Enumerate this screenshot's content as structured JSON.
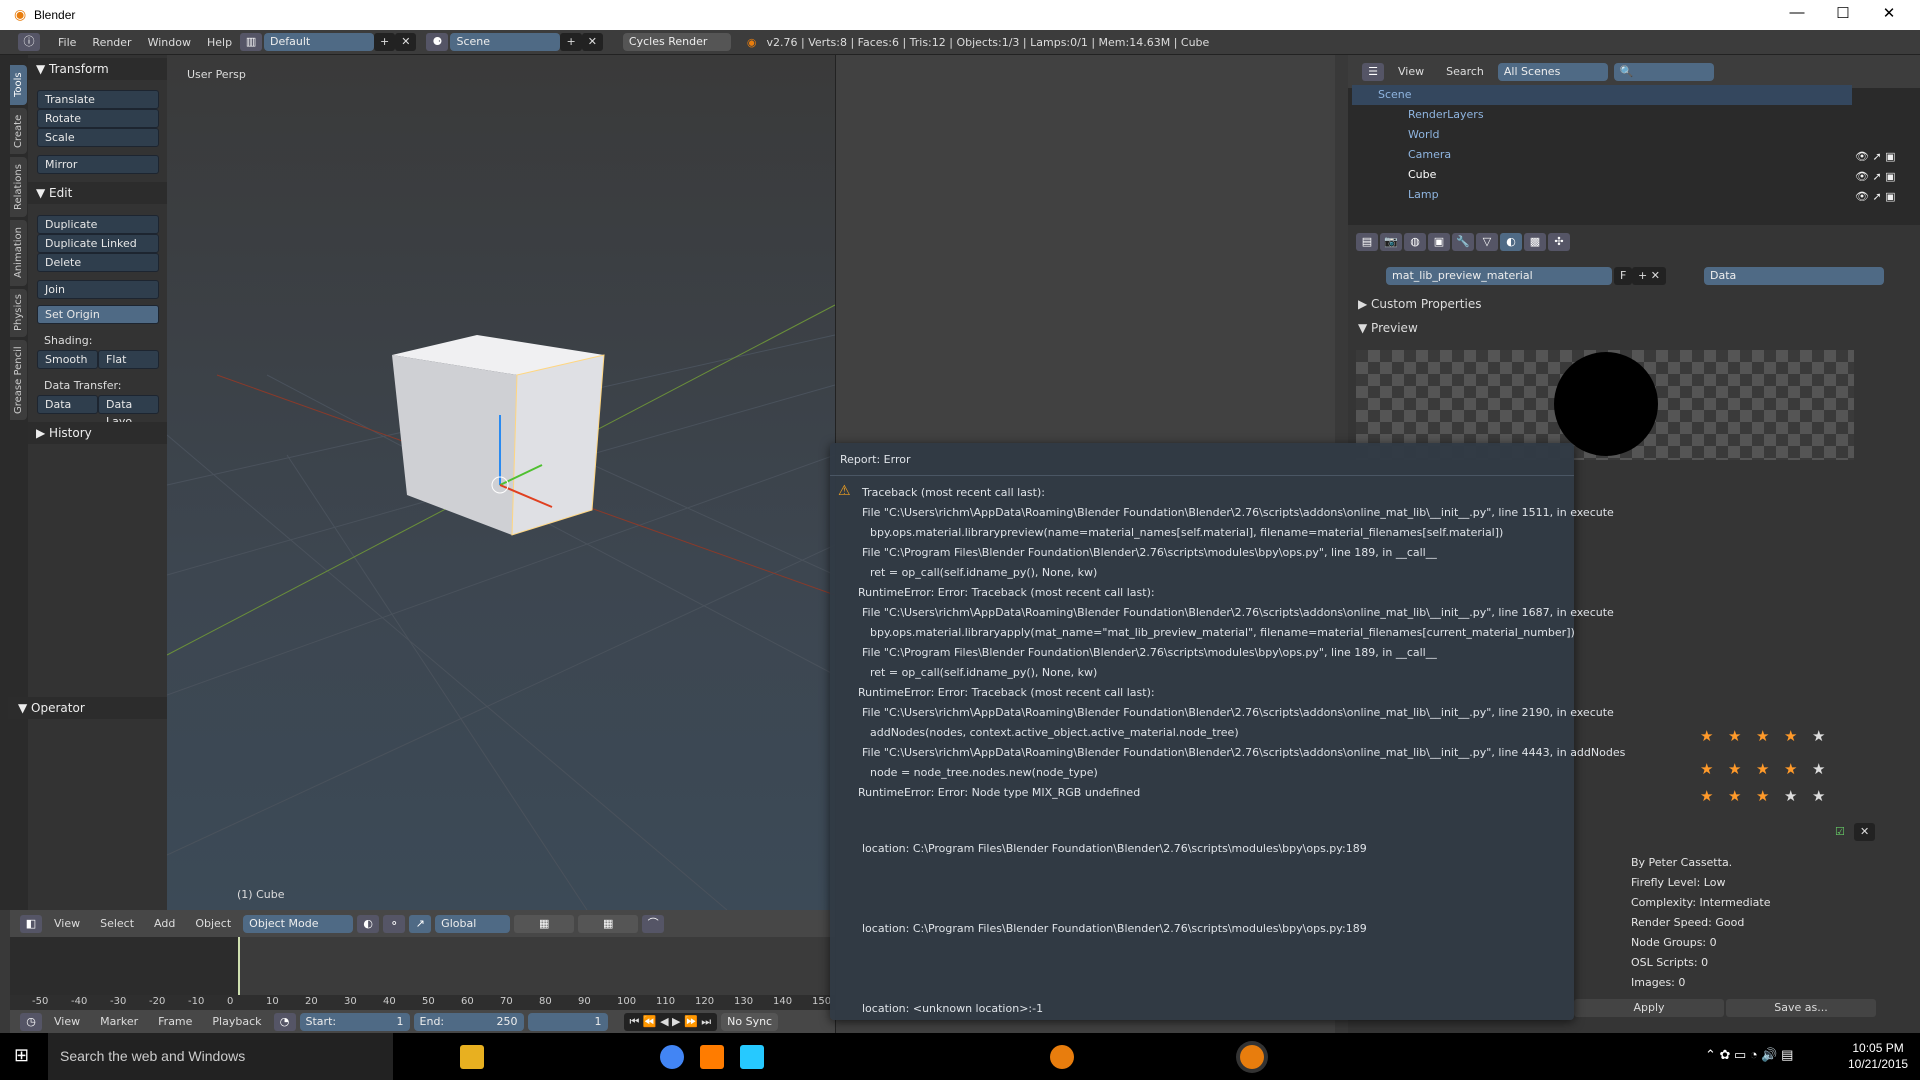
{
  "window": {
    "title": "Blender",
    "min": "—",
    "max": "☐",
    "close": "✕"
  },
  "topbar": {
    "menus": [
      "File",
      "Render",
      "Window",
      "Help"
    ],
    "layout": "Default",
    "scene": "Scene",
    "engine": "Cycles Render",
    "stats": "v2.76 | Verts:8 | Faces:6 | Tris:12 | Objects:1/3 | Lamps:0/1 | Mem:14.63M | Cube"
  },
  "toolshelf": {
    "tabs": [
      "Tools",
      "Create",
      "Relations",
      "Animation",
      "Physics",
      "Grease Pencil"
    ],
    "transform": "Transform",
    "translate": "Translate",
    "rotate": "Rotate",
    "scale": "Scale",
    "mirror": "Mirror",
    "edit": "Edit",
    "duplicate": "Duplicate",
    "duplicate_linked": "Duplicate Linked",
    "delete": "Delete",
    "join": "Join",
    "set_origin": "Set Origin",
    "shading_label": "Shading:",
    "smooth": "Smooth",
    "flat": "Flat",
    "data_transfer_label": "Data Transfer:",
    "data": "Data",
    "data_layo": "Data Layo",
    "history": "History",
    "operator": "Operator"
  },
  "viewport": {
    "label": "User Persp",
    "object": "(1) Cube"
  },
  "view3d_header": {
    "menus": [
      "View",
      "Select",
      "Add",
      "Object"
    ],
    "mode": "Object Mode",
    "orientation": "Global"
  },
  "timeline": {
    "ticks": [
      "-50",
      "-40",
      "-30",
      "-20",
      "-10",
      "0",
      "10",
      "20",
      "30",
      "40",
      "50",
      "60",
      "70",
      "80",
      "90",
      "100",
      "110",
      "120",
      "130",
      "140",
      "150"
    ],
    "current_frame_value": 0
  },
  "timeline_header": {
    "menus": [
      "View",
      "Marker",
      "Frame",
      "Playback"
    ],
    "start_label": "Start:",
    "start": "1",
    "end_label": "End:",
    "end": "250",
    "frame": "1",
    "sync": "No Sync"
  },
  "outliner": {
    "menus": [
      "View",
      "Search"
    ],
    "filter": "All Scenes",
    "items": [
      "Scene",
      "RenderLayers",
      "World",
      "Camera",
      "Cube",
      "Lamp"
    ]
  },
  "properties": {
    "material": "mat_lib_preview_material",
    "fake_user": "F",
    "link": "Data",
    "custom_properties": "Custom Properties",
    "preview": "Preview",
    "ratings": [
      4,
      4,
      3
    ],
    "info": [
      "By Peter Cassetta.",
      "Firefly Level: Low",
      "Complexity: Intermediate",
      "Render Speed: Good",
      "Node Groups: 0",
      "OSL Scripts: 0",
      "Images: 0"
    ],
    "apply": "Apply",
    "save_as": "Save as..."
  },
  "error_popup": {
    "title": "Report: Error",
    "lines": [
      "Traceback (most recent call last):",
      "File \"C:\\Users\\richm\\AppData\\Roaming\\Blender Foundation\\Blender\\2.76\\scripts\\addons\\online_mat_lib\\__init__.py\", line 1511, in execute",
      "bpy.ops.material.librarypreview(name=material_names[self.material], filename=material_filenames[self.material])",
      "File \"C:\\Program Files\\Blender Foundation\\Blender\\2.76\\scripts\\modules\\bpy\\ops.py\", line 189, in __call__",
      "ret = op_call(self.idname_py(), None, kw)",
      "RuntimeError: Error: Traceback (most recent call last):",
      "File \"C:\\Users\\richm\\AppData\\Roaming\\Blender Foundation\\Blender\\2.76\\scripts\\addons\\online_mat_lib\\__init__.py\", line 1687, in execute",
      "bpy.ops.material.libraryapply(mat_name=\"mat_lib_preview_material\", filename=material_filenames[current_material_number])",
      "File \"C:\\Program Files\\Blender Foundation\\Blender\\2.76\\scripts\\modules\\bpy\\ops.py\", line 189, in __call__",
      "ret = op_call(self.idname_py(), None, kw)",
      "RuntimeError: Error: Traceback (most recent call last):",
      "File \"C:\\Users\\richm\\AppData\\Roaming\\Blender Foundation\\Blender\\2.76\\scripts\\addons\\online_mat_lib\\__init__.py\", line 2190, in execute",
      "addNodes(nodes, context.active_object.active_material.node_tree)",
      "File \"C:\\Users\\richm\\AppData\\Roaming\\Blender Foundation\\Blender\\2.76\\scripts\\addons\\online_mat_lib\\__init__.py\", line 4443, in addNodes",
      "node = node_tree.nodes.new(node_type)",
      "RuntimeError: Error: Node type MIX_RGB undefined"
    ],
    "location1": "location: C:\\Program Files\\Blender Foundation\\Blender\\2.76\\scripts\\modules\\bpy\\ops.py:189",
    "location2": "location: C:\\Program Files\\Blender Foundation\\Blender\\2.76\\scripts\\modules\\bpy\\ops.py:189",
    "location3": "location: <unknown location>:-1"
  },
  "taskbar": {
    "search": "Search the web and Windows",
    "time": "10:05 PM",
    "date": "10/21/2015"
  }
}
